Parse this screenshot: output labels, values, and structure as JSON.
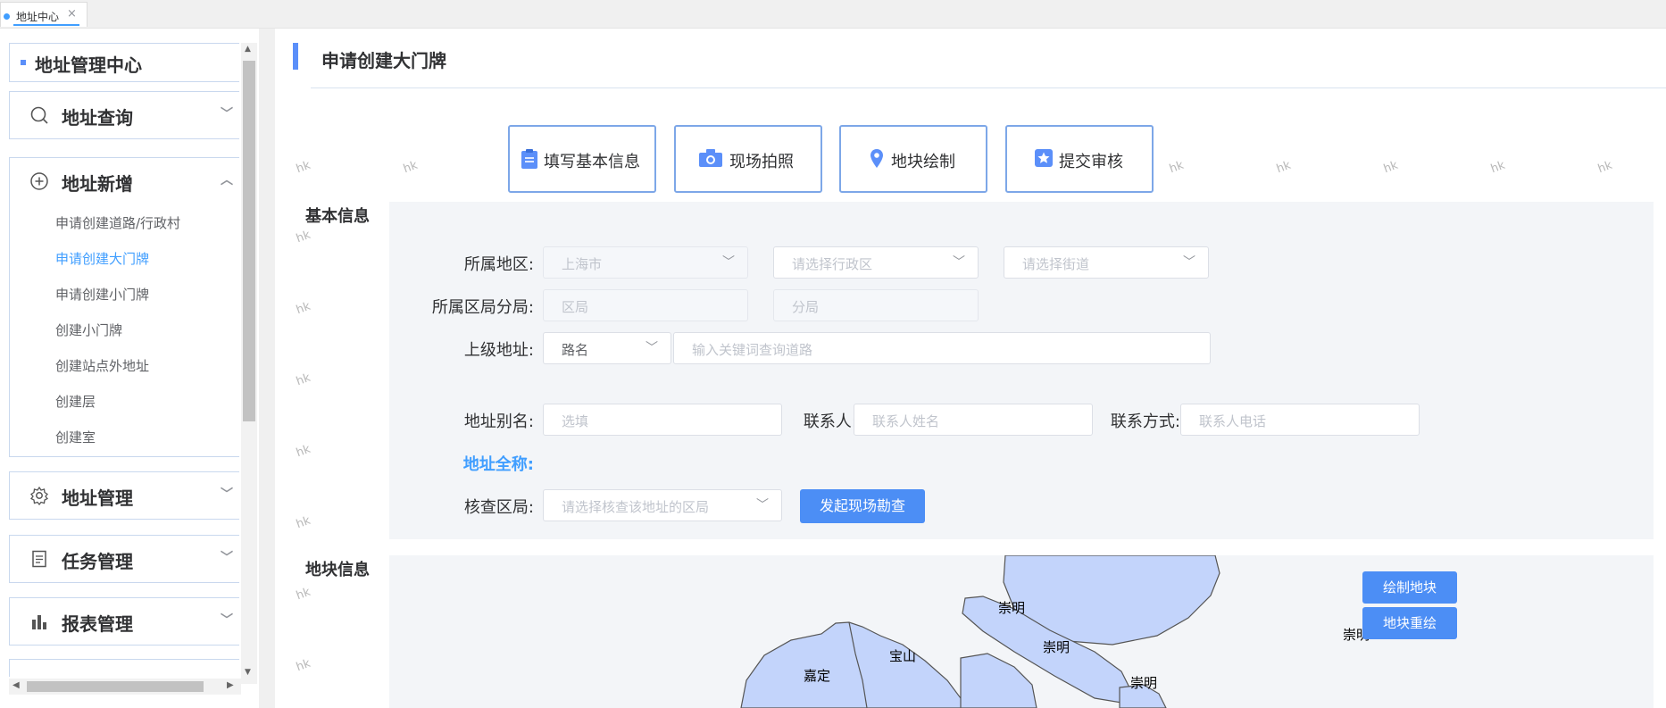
{
  "tabbar": {
    "tab_label": "地址中心",
    "close": "×"
  },
  "sidebar": {
    "header": "地址管理中心",
    "groups": [
      {
        "label": "地址查询",
        "icon": "search-icon",
        "expanded": false
      },
      {
        "label": "地址新增",
        "icon": "plus-circle-icon",
        "expanded": true,
        "items": [
          "申请创建道路/行政村",
          "申请创建大门牌",
          "申请创建小门牌",
          "创建小门牌",
          "创建站点外地址",
          "创建层",
          "创建室"
        ]
      },
      {
        "label": "地址管理",
        "icon": "gear-icon",
        "expanded": false
      },
      {
        "label": "任务管理",
        "icon": "document-icon",
        "expanded": false
      },
      {
        "label": "报表管理",
        "icon": "bar-chart-icon",
        "expanded": false
      }
    ],
    "active_item": "申请创建大门牌"
  },
  "main": {
    "page_title": "申请创建大门牌",
    "steps": [
      "填写基本信息",
      "现场拍照",
      "地块绘制",
      "提交审核"
    ],
    "watermark": "hk",
    "basic_info": {
      "section_label": "基本信息",
      "region_label": "所属地区:",
      "city_value": "上海市",
      "district_placeholder": "请选择行政区",
      "street_placeholder": "请选择街道",
      "bureau_label": "所属区局分局:",
      "bureau_placeholder": "区局",
      "sub_bureau_placeholder": "分局",
      "parent_label": "上级地址:",
      "parent_type_value": "路名",
      "parent_search_placeholder": "输入关键词查询道路",
      "alias_label": "地址别名:",
      "alias_placeholder": "选填",
      "contact_label": "联系人:",
      "contact_placeholder": "联系人姓名",
      "phone_label": "联系方式:",
      "phone_placeholder": "联系人电话",
      "full_name_label": "地址全称:",
      "check_bureau_label": "核查区局:",
      "check_bureau_placeholder": "请选择核查该地址的区局",
      "survey_button": "发起现场勘查"
    },
    "parcel_info": {
      "section_label": "地块信息",
      "draw_button": "绘制地块",
      "redraw_button": "地块重绘",
      "map_labels": [
        "崇明",
        "崇明",
        "崇明",
        "宝山",
        "嘉定",
        "崇明"
      ]
    }
  },
  "colors": {
    "accent": "#409eff",
    "primary_button": "#4c8ef5",
    "map_fill": "#c3d4fb"
  }
}
